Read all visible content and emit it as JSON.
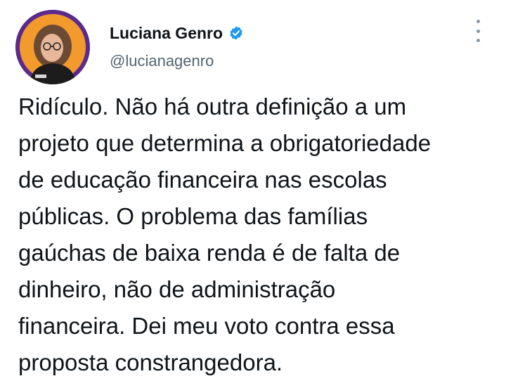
{
  "author": {
    "display_name": "Luciana Genro",
    "handle": "@lucianagenro",
    "verified": true,
    "avatar_icon": "profile-photo-avatar"
  },
  "tweet": {
    "lines": [
      "Ridículo. Não há outra definição a um",
      "projeto que determina a obrigatoriedade",
      "de educação financeira nas escolas",
      "públicas. O problema das famílias",
      "gaúchas de baixa renda é de falta de",
      "dinheiro, não de administração",
      "financeira. Dei meu voto contra essa",
      "proposta constrangedora."
    ]
  },
  "icons": {
    "verified": "verified-badge-icon",
    "more": "more-options-icon"
  },
  "colors": {
    "verified_blue": "#1d9bf0",
    "avatar_ring": "#5a2a8c",
    "avatar_bg": "#f39a2d",
    "text": "#0f1419",
    "secondary_text": "#536471"
  }
}
